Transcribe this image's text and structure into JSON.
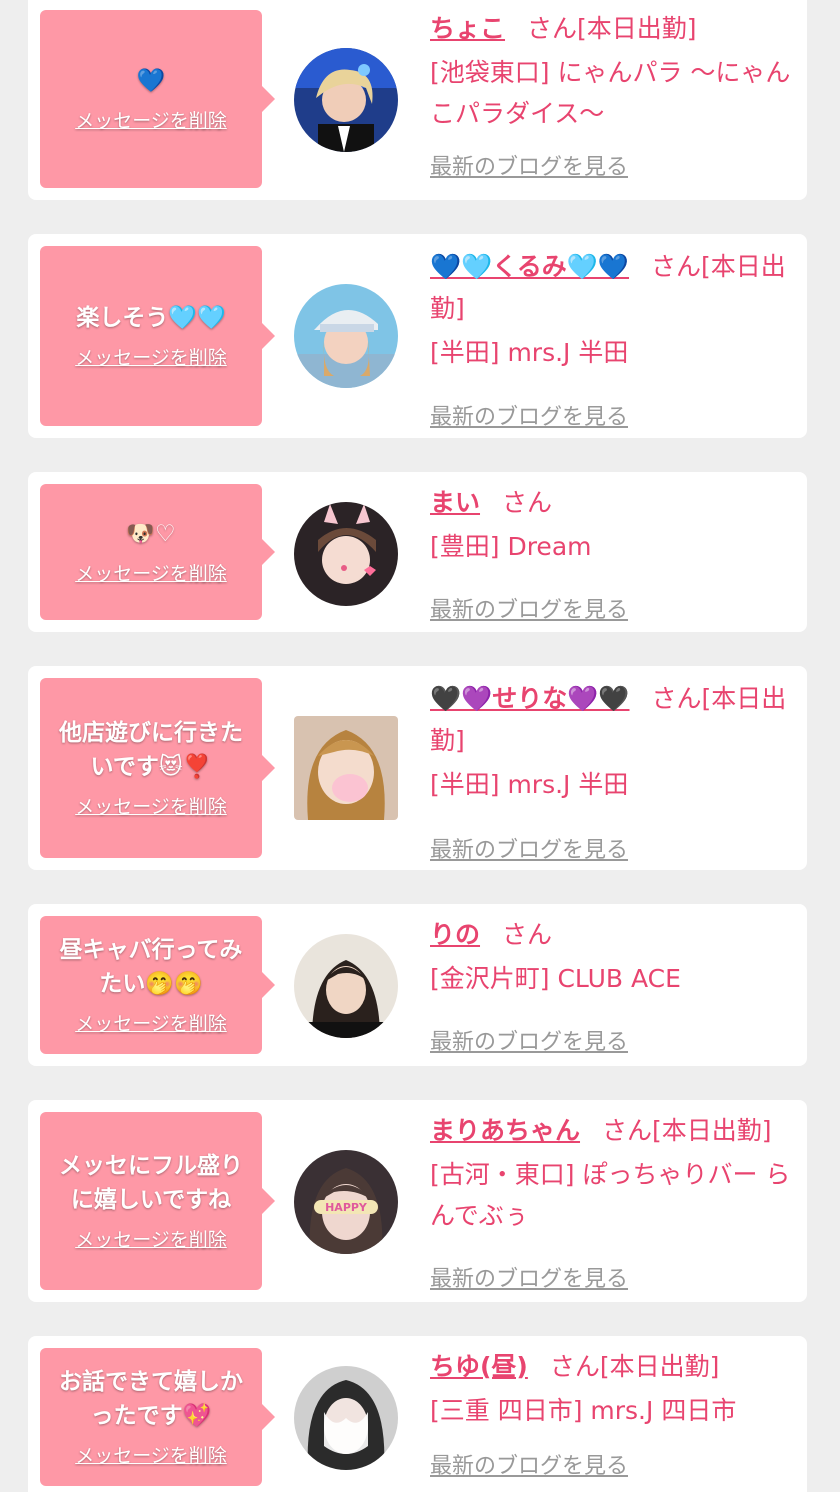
{
  "colors": {
    "page_bg": "#eeeeee",
    "card_bg": "#ffffff",
    "bubble_bg": "#fe98a6",
    "accent_pink": "#e8446f",
    "link_gray": "#999999"
  },
  "delete_label": "メッセージを削除",
  "blog_label": "最新のブログを見る",
  "cards": [
    {
      "message": "💙",
      "name": "ちょこ",
      "suffix": "さん[本日出勤]",
      "shop": "[池袋東口] にゃんパラ 〜にゃんこパラダイス〜",
      "avatar_icon": "profile-photo"
    },
    {
      "message": "楽しそう🩵🩵",
      "name": "💙🩵くるみ🩵💙",
      "suffix": "さん[本日出勤]",
      "shop": "[半田] mrs.J 半田",
      "avatar_icon": "profile-photo"
    },
    {
      "message": "🐶♡",
      "name": "まい",
      "suffix": "さん",
      "shop": "[豊田] Dream",
      "avatar_icon": "profile-photo"
    },
    {
      "message": "他店遊びに行きたいです😻❣️",
      "name": "🖤💜せりな💜🖤",
      "suffix": "さん[本日出勤]",
      "shop": "[半田] mrs.J 半田",
      "avatar_icon": "profile-photo"
    },
    {
      "message": "昼キャバ行ってみたい🤭🤭",
      "name": "りの",
      "suffix": "さん",
      "shop": "[金沢片町] CLUB ACE",
      "avatar_icon": "profile-photo"
    },
    {
      "message": "メッセにフル盛りに嬉しいですね",
      "name": "まりあちゃん",
      "suffix": "さん[本日出勤]",
      "shop": "[古河・東口] ぽっちゃりバー らんでぶぅ",
      "avatar_icon": "profile-photo"
    },
    {
      "message": "お話できて嬉しかったです💖",
      "name": "ちゆ(昼)",
      "suffix": "さん[本日出勤]",
      "shop": "[三重 四日市] mrs.J 四日市",
      "avatar_icon": "profile-photo"
    }
  ]
}
